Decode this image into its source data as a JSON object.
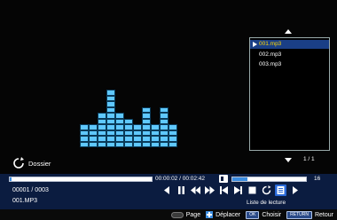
{
  "folder": {
    "label": "Dossier",
    "icon": "rotate-icon"
  },
  "playlist": {
    "items": [
      "001.mp3",
      "002.mp3",
      "003.mp3"
    ],
    "selected_index": 0,
    "page": "1 / 1",
    "label": "Liste de lecture"
  },
  "playback": {
    "time": "00:00:02 / 00:02:42",
    "progress_fraction": 0.015,
    "volume": "16",
    "volume_fraction": 0.2,
    "track_index": "00001 / 0003",
    "track_name": "001.MP3"
  },
  "equalizer": {
    "levels": [
      4,
      4,
      6,
      10,
      6,
      5,
      4,
      7,
      4,
      7,
      4
    ]
  },
  "controls": [
    "prev-icon",
    "pause-icon",
    "rewind-icon",
    "forward-icon",
    "skip-prev-icon",
    "skip-next-icon",
    "stop-icon",
    "repeat-icon",
    "playlist-icon",
    "next-icon"
  ],
  "help": {
    "page": {
      "badge": "",
      "label": "Page"
    },
    "move": {
      "label": "Déplacer"
    },
    "choose": {
      "badge": "OK",
      "label": "Choisir"
    },
    "back": {
      "badge": "RETURN",
      "label": "Retour"
    }
  },
  "colors": {
    "accent": "#3c8de0",
    "band": "#0b1c40",
    "selected": "#1a3f86",
    "highlight_text": "#ffd800",
    "equalizer": "#5fc8ff"
  }
}
